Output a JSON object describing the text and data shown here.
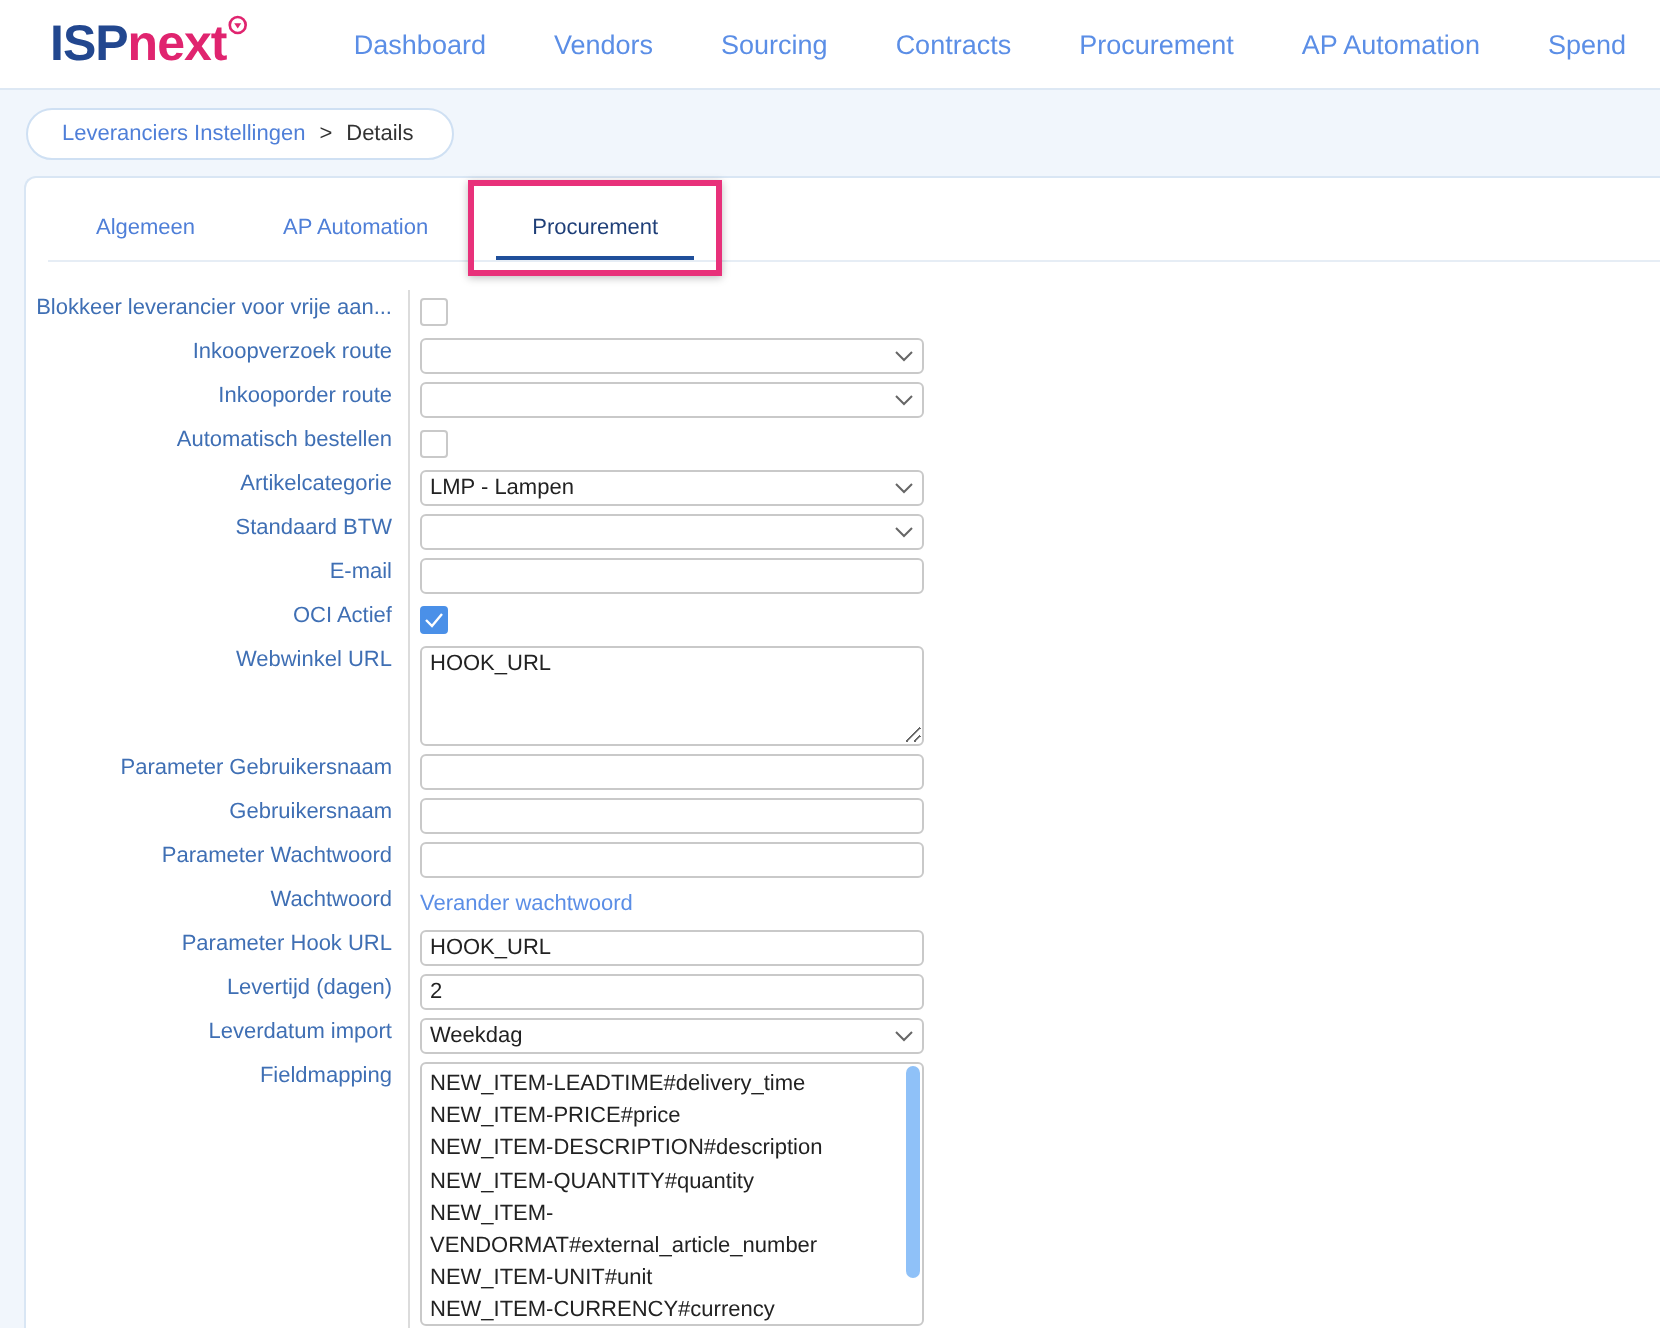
{
  "logo": {
    "parts": [
      "ISP",
      "next"
    ]
  },
  "nav": [
    {
      "label": "Dashboard"
    },
    {
      "label": "Vendors"
    },
    {
      "label": "Sourcing"
    },
    {
      "label": "Contracts"
    },
    {
      "label": "Procurement"
    },
    {
      "label": "AP Automation"
    },
    {
      "label": "Spend"
    }
  ],
  "breadcrumb": {
    "items": [
      "Leveranciers Instellingen",
      "Details"
    ],
    "separator": ">"
  },
  "tabs": [
    {
      "label": "Algemeen",
      "selected": false,
      "highlighted": false
    },
    {
      "label": "AP Automation",
      "selected": false,
      "highlighted": false
    },
    {
      "label": "Procurement",
      "selected": true,
      "highlighted": true
    }
  ],
  "fields": [
    {
      "label": "Blokkeer leverancier voor vrije aan...",
      "kind": "checkbox",
      "checked": false
    },
    {
      "label": "Inkoopverzoek route",
      "kind": "select"
    },
    {
      "label": "Inkooporder route",
      "kind": "select"
    },
    {
      "label": "Automatisch bestellen",
      "kind": "checkbox",
      "checked": false
    },
    {
      "label": "Artikelcategorie",
      "kind": "select",
      "value": "LMP - Lampen"
    },
    {
      "label": "Standaard BTW",
      "kind": "select"
    },
    {
      "label": "E-mail",
      "kind": "input"
    },
    {
      "label": "OCI Actief",
      "kind": "checkbox",
      "checked": true
    },
    {
      "label": "Webwinkel URL",
      "kind": "textarea",
      "value": "HOOK_URL"
    },
    {
      "label": "Parameter Gebruikersnaam",
      "kind": "input"
    },
    {
      "label": "Gebruikersnaam",
      "kind": "input"
    },
    {
      "label": "Parameter Wachtwoord",
      "kind": "input"
    },
    {
      "label": "Wachtwoord",
      "kind": "link",
      "value": "Verander wachtwoord"
    },
    {
      "label": "Parameter Hook URL",
      "kind": "input",
      "value": "HOOK_URL"
    },
    {
      "label": "Levertijd (dagen)",
      "kind": "input",
      "value": "2"
    },
    {
      "label": "Leverdatum import",
      "kind": "select",
      "value": "Weekdag"
    },
    {
      "label": "Fieldmapping",
      "kind": "mapping",
      "lines": [
        "NEW_ITEM-LEADTIME#delivery_time",
        "NEW_ITEM-PRICE#price",
        "NEW_ITEM-DESCRIPTION#description",
        "NEW_ITEM-QUANTITY#quantity",
        "NEW_ITEM-",
        "VENDORMAT#external_article_number",
        "NEW_ITEM-UNIT#unit",
        "NEW_ITEM-CURRENCY#currency"
      ]
    }
  ]
}
